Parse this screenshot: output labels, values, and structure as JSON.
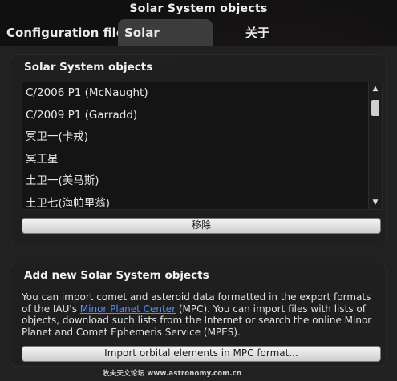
{
  "window": {
    "title": "Solar System objects"
  },
  "tabs": [
    {
      "label": "Configuration file"
    },
    {
      "label": "Solar System"
    },
    {
      "label": "关于"
    }
  ],
  "solar_objects": {
    "title": "Solar System objects",
    "items": [
      "C/2006 P1 (McNaught)",
      "C/2009 P1 (Garradd)",
      "冥卫一(卡戎)",
      "冥王星",
      "土卫一(美马斯)",
      "土卫七(海帕里翁)"
    ],
    "remove_label": "移除"
  },
  "add_new": {
    "title": "Add new Solar System objects",
    "desc_before_link": "You can import comet and asteroid data formatted in the export formats of the IAU's ",
    "link_text": "Minor Planet Center",
    "desc_after_link": " (MPC). You can import files with lists of objects, download such lists from the Internet or search the online Minor Planet and Comet Ephemeris Service (MPES).",
    "import_label": "Import orbital elements in MPC format..."
  },
  "watermark": "牧夫天文论坛 www.astronomy.com.cn"
}
